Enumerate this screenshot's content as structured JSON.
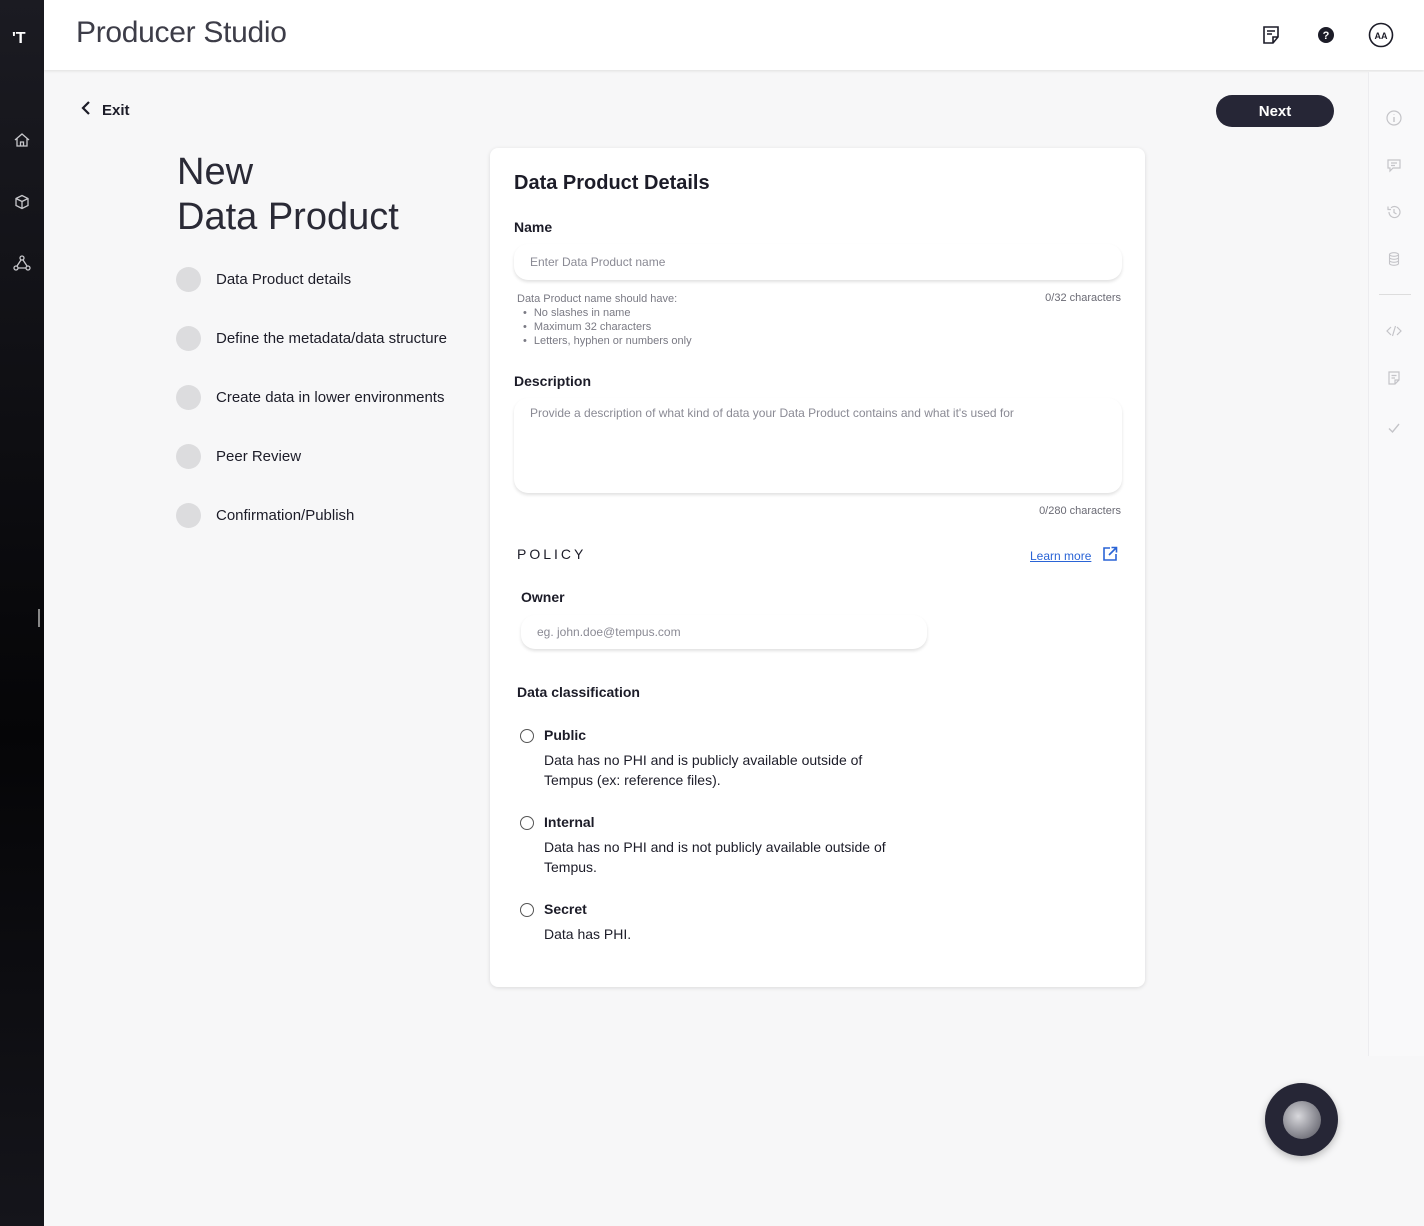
{
  "app": {
    "logo": "'T",
    "title": "Producer Studio",
    "avatar": "AA"
  },
  "nav": {
    "icons": [
      "home-icon",
      "package-icon",
      "network-icon"
    ]
  },
  "header_icons": [
    "notes-icon",
    "help-icon",
    "avatar-icon"
  ],
  "right_rail_icons": [
    "info-icon",
    "comment-icon",
    "history-icon",
    "database-icon",
    "code-icon",
    "document-icon",
    "check-icon"
  ],
  "actions": {
    "exit_label": "Exit",
    "next_label": "Next"
  },
  "page": {
    "heading_line1": "New",
    "heading_line2": "Data Product",
    "steps": [
      {
        "label": "Data Product details"
      },
      {
        "label": "Define the metadata/data structure"
      },
      {
        "label": "Create data in lower environments"
      },
      {
        "label": "Peer Review"
      },
      {
        "label": "Confirmation/Publish"
      }
    ]
  },
  "form": {
    "title": "Data Product Details",
    "name": {
      "label": "Name",
      "placeholder": "Enter Data Product name",
      "rules_title": "Data Product name should have:",
      "rules": [
        "No slashes in name",
        "Maximum 32 characters",
        "Letters, hyphen or numbers only"
      ],
      "counter": "0/32 characters"
    },
    "description": {
      "label": "Description",
      "placeholder": "Provide a description of what kind of data your Data Product contains and what it's used for",
      "counter": "0/280 characters"
    },
    "policy": {
      "title": "POLICY",
      "learn_more": "Learn more",
      "owner_label": "Owner",
      "owner_placeholder": "eg. john.doe@tempus.com"
    },
    "classification": {
      "label": "Data classification",
      "options": [
        {
          "name": "Public",
          "desc": "Data has no PHI and is publicly available outside of Tempus (ex: reference files)."
        },
        {
          "name": "Internal",
          "desc": "Data has no PHI and is not publicly available outside of Tempus."
        },
        {
          "name": "Secret",
          "desc": "Data has PHI."
        }
      ]
    }
  }
}
